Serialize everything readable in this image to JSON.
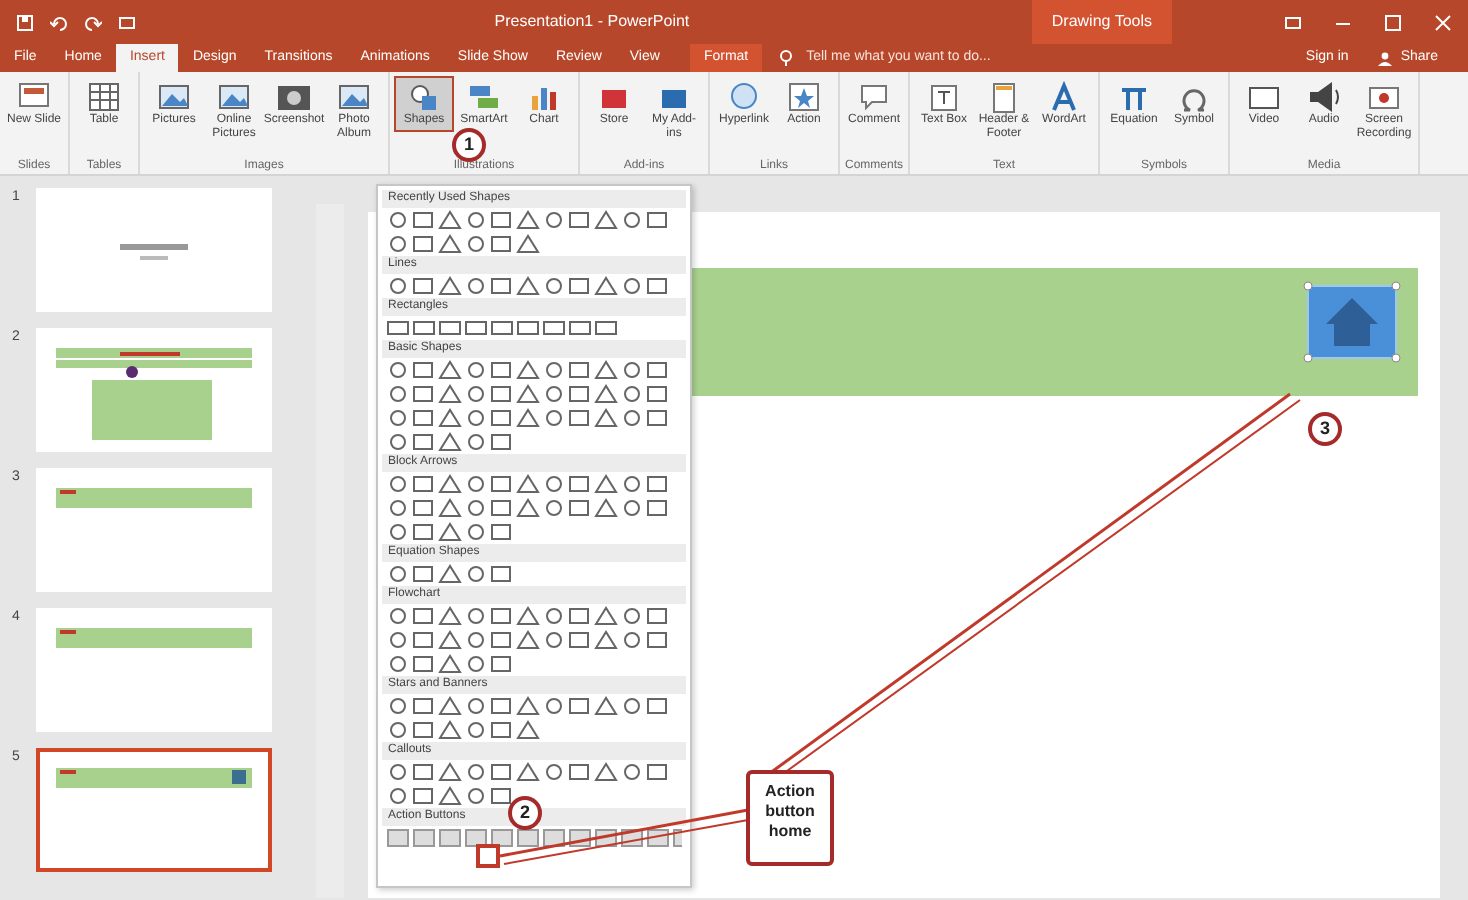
{
  "window": {
    "title": "Presentation1 - PowerPoint",
    "context_label": "Drawing Tools"
  },
  "tabs": [
    {
      "label": "File",
      "selected": false
    },
    {
      "label": "Home",
      "selected": false
    },
    {
      "label": "Insert",
      "selected": true
    },
    {
      "label": "Design",
      "selected": false
    },
    {
      "label": "Transitions",
      "selected": false
    },
    {
      "label": "Animations",
      "selected": false
    },
    {
      "label": "Slide Show",
      "selected": false
    },
    {
      "label": "Review",
      "selected": false
    },
    {
      "label": "View",
      "selected": false
    },
    {
      "label": "Format",
      "selected": false,
      "kind": "context"
    }
  ],
  "tell_me": {
    "placeholder": "Tell me what you want to do..."
  },
  "account": {
    "sign_in": "Sign in",
    "share": "Share"
  },
  "ribbon_groups": [
    {
      "label": "Slides",
      "buttons": [
        {
          "label": "New Slide",
          "selected": false
        }
      ]
    },
    {
      "label": "Tables",
      "buttons": [
        {
          "label": "Table",
          "selected": false
        }
      ]
    },
    {
      "label": "Images",
      "buttons": [
        {
          "label": "Pictures",
          "selected": false
        },
        {
          "label": "Online Pictures",
          "selected": false
        },
        {
          "label": "Screenshot",
          "selected": false
        },
        {
          "label": "Photo Album",
          "selected": false
        }
      ]
    },
    {
      "label": "Illustrations",
      "buttons": [
        {
          "label": "Shapes",
          "selected": true
        },
        {
          "label": "SmartArt",
          "selected": false
        },
        {
          "label": "Chart",
          "selected": false
        }
      ]
    },
    {
      "label": "Add-ins",
      "buttons": [
        {
          "label": "Store",
          "selected": false
        },
        {
          "label": "My Add-ins",
          "selected": false
        }
      ]
    },
    {
      "label": "Links",
      "buttons": [
        {
          "label": "Hyperlink",
          "selected": false
        },
        {
          "label": "Action",
          "selected": false
        }
      ]
    },
    {
      "label": "Comments",
      "buttons": [
        {
          "label": "Comment",
          "selected": false
        }
      ]
    },
    {
      "label": "Text",
      "buttons": [
        {
          "label": "Text Box",
          "selected": false
        },
        {
          "label": "Header & Footer",
          "selected": false
        },
        {
          "label": "WordArt",
          "selected": false
        }
      ]
    },
    {
      "label": "Symbols",
      "buttons": [
        {
          "label": "Equation",
          "selected": false
        },
        {
          "label": "Symbol",
          "selected": false
        }
      ]
    },
    {
      "label": "Media",
      "buttons": [
        {
          "label": "Video",
          "selected": false
        },
        {
          "label": "Audio",
          "selected": false
        },
        {
          "label": "Screen Recording",
          "selected": false
        }
      ]
    }
  ],
  "slides": [
    {
      "number": "1",
      "kind": "title",
      "selected": false
    },
    {
      "number": "2",
      "kind": "content",
      "selected": false
    },
    {
      "number": "3",
      "kind": "header",
      "selected": false
    },
    {
      "number": "4",
      "kind": "header",
      "selected": false
    },
    {
      "number": "5",
      "kind": "header_button",
      "selected": true
    }
  ],
  "shapes_menu": {
    "sections": [
      {
        "heading": "Recently Used Shapes"
      },
      {
        "heading": "Lines"
      },
      {
        "heading": "Rectangles"
      },
      {
        "heading": "Basic Shapes"
      },
      {
        "heading": "Block Arrows"
      },
      {
        "heading": "Equation Shapes"
      },
      {
        "heading": "Flowchart"
      },
      {
        "heading": "Stars and Banners"
      },
      {
        "heading": "Callouts"
      },
      {
        "heading": "Action Buttons"
      }
    ]
  },
  "annotations": [
    {
      "number": "1"
    },
    {
      "number": "2"
    },
    {
      "number": "3"
    }
  ],
  "callout_box": {
    "text": "Action button home"
  }
}
